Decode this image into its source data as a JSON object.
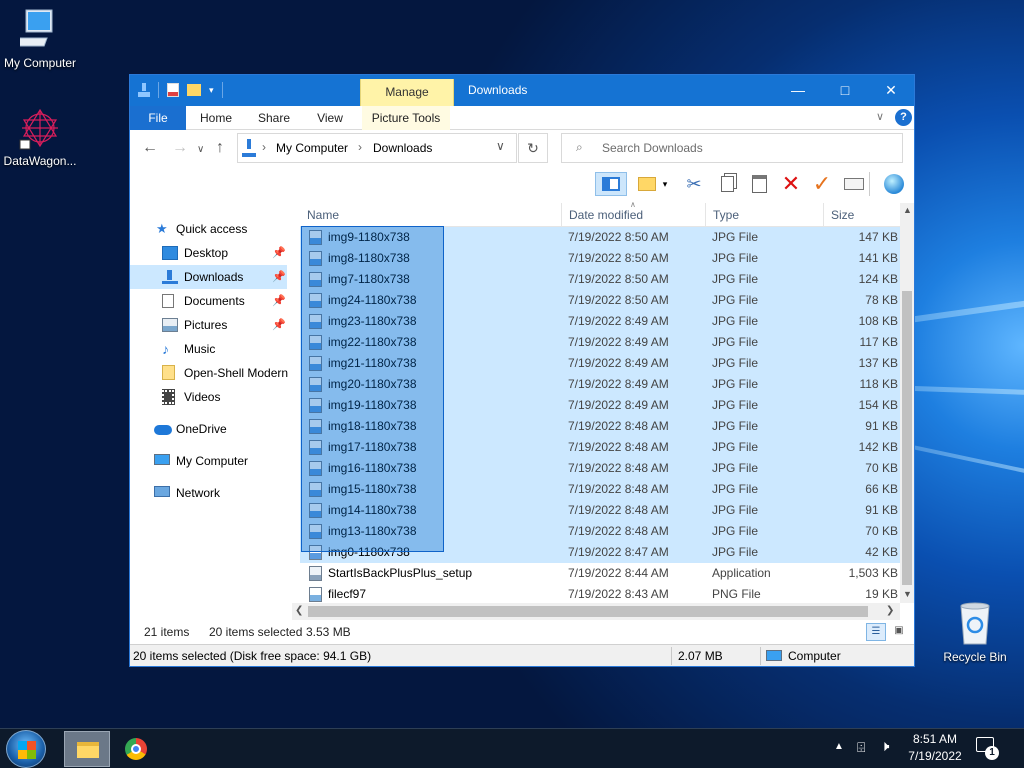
{
  "desktop": {
    "icons": [
      {
        "label": "My Computer",
        "icon": "my-computer-icon"
      },
      {
        "label": "DataWagon...",
        "icon": "datawagon-icon"
      },
      {
        "label": "Recycle Bin",
        "icon": "recycle-bin-icon"
      }
    ]
  },
  "window": {
    "context_tab": "Manage",
    "title": "Downloads",
    "ribbon_tabs": [
      "File",
      "Home",
      "Share",
      "View",
      "Picture Tools"
    ],
    "address": {
      "root": "My Computer",
      "current": "Downloads"
    },
    "search_placeholder": "Search Downloads"
  },
  "nav": {
    "quick_access": "Quick access",
    "items": [
      {
        "label": "Desktop",
        "icon": "desktop-icon",
        "pinned": true
      },
      {
        "label": "Downloads",
        "icon": "downloads-icon",
        "pinned": true,
        "selected": true
      },
      {
        "label": "Documents",
        "icon": "documents-icon",
        "pinned": true
      },
      {
        "label": "Pictures",
        "icon": "pictures-icon",
        "pinned": true
      },
      {
        "label": "Music",
        "icon": "music-icon",
        "pinned": false
      },
      {
        "label": "Open-Shell Modern",
        "icon": "folder-icon",
        "pinned": false
      },
      {
        "label": "Videos",
        "icon": "videos-icon",
        "pinned": false
      }
    ],
    "onedrive": "OneDrive",
    "my_computer": "My Computer",
    "network": "Network"
  },
  "columns": [
    "Name",
    "Date modified",
    "Type",
    "Size"
  ],
  "files": [
    {
      "name": "img9-1180x738",
      "date": "7/19/2022 8:50 AM",
      "type": "JPG File",
      "size": "147 KB",
      "selected": true
    },
    {
      "name": "img8-1180x738",
      "date": "7/19/2022 8:50 AM",
      "type": "JPG File",
      "size": "141 KB",
      "selected": true
    },
    {
      "name": "img7-1180x738",
      "date": "7/19/2022 8:50 AM",
      "type": "JPG File",
      "size": "124 KB",
      "selected": true
    },
    {
      "name": "img24-1180x738",
      "date": "7/19/2022 8:50 AM",
      "type": "JPG File",
      "size": "78 KB",
      "selected": true
    },
    {
      "name": "img23-1180x738",
      "date": "7/19/2022 8:49 AM",
      "type": "JPG File",
      "size": "108 KB",
      "selected": true
    },
    {
      "name": "img22-1180x738",
      "date": "7/19/2022 8:49 AM",
      "type": "JPG File",
      "size": "117 KB",
      "selected": true
    },
    {
      "name": "img21-1180x738",
      "date": "7/19/2022 8:49 AM",
      "type": "JPG File",
      "size": "137 KB",
      "selected": true
    },
    {
      "name": "img20-1180x738",
      "date": "7/19/2022 8:49 AM",
      "type": "JPG File",
      "size": "118 KB",
      "selected": true
    },
    {
      "name": "img19-1180x738",
      "date": "7/19/2022 8:49 AM",
      "type": "JPG File",
      "size": "154 KB",
      "selected": true
    },
    {
      "name": "img18-1180x738",
      "date": "7/19/2022 8:48 AM",
      "type": "JPG File",
      "size": "91 KB",
      "selected": true
    },
    {
      "name": "img17-1180x738",
      "date": "7/19/2022 8:48 AM",
      "type": "JPG File",
      "size": "142 KB",
      "selected": true
    },
    {
      "name": "img16-1180x738",
      "date": "7/19/2022 8:48 AM",
      "type": "JPG File",
      "size": "70 KB",
      "selected": true
    },
    {
      "name": "img15-1180x738",
      "date": "7/19/2022 8:48 AM",
      "type": "JPG File",
      "size": "66 KB",
      "selected": true
    },
    {
      "name": "img14-1180x738",
      "date": "7/19/2022 8:48 AM",
      "type": "JPG File",
      "size": "91 KB",
      "selected": true
    },
    {
      "name": "img13-1180x738",
      "date": "7/19/2022 8:48 AM",
      "type": "JPG File",
      "size": "70 KB",
      "selected": true
    },
    {
      "name": "img0-1180x738",
      "date": "7/19/2022 8:47 AM",
      "type": "JPG File",
      "size": "42 KB",
      "selected": true
    },
    {
      "name": "StartIsBackPlusPlus_setup",
      "date": "7/19/2022 8:44 AM",
      "type": "Application",
      "size": "1,503 KB",
      "selected": false
    },
    {
      "name": "filecf97",
      "date": "7/19/2022 8:43 AM",
      "type": "PNG File",
      "size": "19 KB",
      "selected": false
    }
  ],
  "status": {
    "count": "21 items",
    "selected": "20 items selected",
    "selected_size": "3.53 MB",
    "detail": "20 items selected (Disk free space: 94.1 GB)",
    "detail_size": "2.07 MB",
    "location": "Computer"
  },
  "taskbar": {
    "time": "8:51 AM",
    "date": "7/19/2022",
    "notification_count": "1"
  },
  "colors": {
    "accent": "#1573d3",
    "selection": "#cce8ff",
    "context_tab": "#fff3a8"
  }
}
